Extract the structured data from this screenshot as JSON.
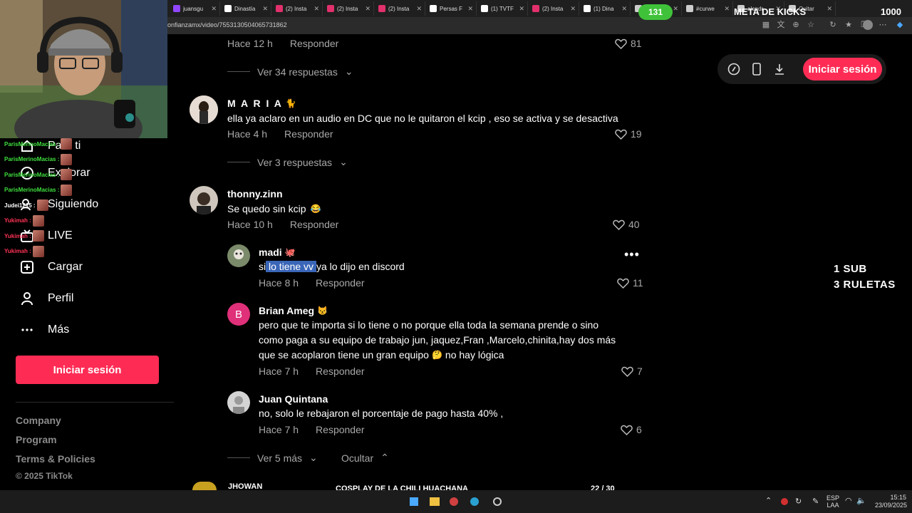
{
  "browser": {
    "tabs": [
      {
        "label": "juansgu",
        "color": "#9146ff"
      },
      {
        "label": "Dinastía",
        "color": "#ffffff"
      },
      {
        "label": "(2) Insta",
        "color": "#e1306c"
      },
      {
        "label": "(2) Insta",
        "color": "#e1306c"
      },
      {
        "label": "(2) Insta",
        "color": "#e1306c"
      },
      {
        "label": "Persas F",
        "color": "#ffffff"
      },
      {
        "label": "(1) TVTF",
        "color": "#ffffff"
      },
      {
        "label": "(2) Insta",
        "color": "#e1306c"
      },
      {
        "label": "(1) Dina",
        "color": "#ffffff"
      },
      {
        "label": "Simul",
        "color": "#cccccc"
      },
      {
        "label": "#curwe",
        "color": "#cccccc"
      },
      {
        "label": "alondr",
        "color": "#cccccc"
      },
      {
        "label": "Quitar",
        "color": "#cccccc"
      }
    ],
    "url": "onfianzamx/video/7553130504065731862"
  },
  "overlay": {
    "meta_value": "131",
    "meta_label": "META DE KICKS",
    "meta_target": "1000",
    "sub_line1": "1 SUB",
    "sub_line2": "3 RULETAS",
    "goal_label": "COSPLAY DE LA CHILI HUACHANA",
    "goal_count": "22",
    "goal_total": "/ 30",
    "goal_progress": 0.73
  },
  "chat": [
    {
      "user": "ParisMerinoMacias :",
      "color": "#3fe03f"
    },
    {
      "user": "ParisMerinoMacias :",
      "color": "#3fe03f"
    },
    {
      "user": "ParisMerinoMacias :",
      "color": "#3fe03f"
    },
    {
      "user": "ParisMerinoMacias :",
      "color": "#3fe03f"
    },
    {
      "user": "Judei1215 :",
      "color": "#ffffff"
    },
    {
      "user": "Yukimah :",
      "color": "#ff3355"
    },
    {
      "user": "Yukimah :",
      "color": "#ff3355"
    },
    {
      "user": "Yukimah :",
      "color": "#ff3355"
    }
  ],
  "sidebar": {
    "items": [
      {
        "label": "Para ti",
        "icon": "home-icon"
      },
      {
        "label": "Explorar",
        "icon": "compass-icon"
      },
      {
        "label": "Siguiendo",
        "icon": "following-icon"
      },
      {
        "label": "LIVE",
        "icon": "live-icon"
      },
      {
        "label": "Cargar",
        "icon": "upload-icon"
      },
      {
        "label": "Perfil",
        "icon": "profile-icon"
      },
      {
        "label": "Más",
        "icon": "more-icon"
      }
    ],
    "login": "Iniciar sesión",
    "footer": [
      "Company",
      "Program",
      "Terms & Policies"
    ],
    "copyright": "© 2025 TikTok"
  },
  "topbar": {
    "login": "Iniciar sesión"
  },
  "comments": {
    "top": {
      "time": "Hace 12 h",
      "reply": "Responder",
      "likes": "81",
      "view_replies": "Ver 34 respuestas"
    },
    "c1": {
      "user": "M A R I A",
      "text": "ella ya aclaro en un audio en DC que no le quitaron el kcip , eso se activa y se desactiva",
      "time": "Hace 4 h",
      "reply": "Responder",
      "likes": "19",
      "view_replies": "Ver 3 respuestas"
    },
    "c2": {
      "user": "thonny.zinn",
      "text": "Se quedo sin kcip",
      "time": "Hace 10 h",
      "reply": "Responder",
      "likes": "40"
    },
    "r1": {
      "user": "madi",
      "text_pre": "si",
      "text_sel": " lo tiene vv ",
      "text_post": "ya lo dijo en discord",
      "time": "Hace 8 h",
      "reply": "Responder",
      "likes": "11"
    },
    "r2": {
      "user": "Brian Ameg",
      "avatar_letter": "B",
      "line1": "pero que te importa si lo tiene o no porque ella toda la semana prende o sino",
      "line2": "como paga a su equipo de trabajo jun, jaquez,Fran ,Marcelo,chinita,hay dos más",
      "line3": "que se acoplaron tiene un gran equipo",
      "line3b": "no hay lógica",
      "time": "Hace 7 h",
      "reply": "Responder",
      "likes": "7"
    },
    "r3": {
      "user": "Juan Quintana",
      "text": "no, solo le rebajaron el porcentaje de pago hasta 40% ,",
      "time": "Hace 7 h",
      "reply": "Responder",
      "likes": "6"
    },
    "more": {
      "view_more": "Ver 5 más",
      "hide": "Ocultar"
    },
    "c3": {
      "user": "JHOWAN"
    }
  },
  "taskbar": {
    "lang1": "ESP",
    "lang2": "LAA",
    "time": "15:15",
    "date": "23/09/2025"
  }
}
